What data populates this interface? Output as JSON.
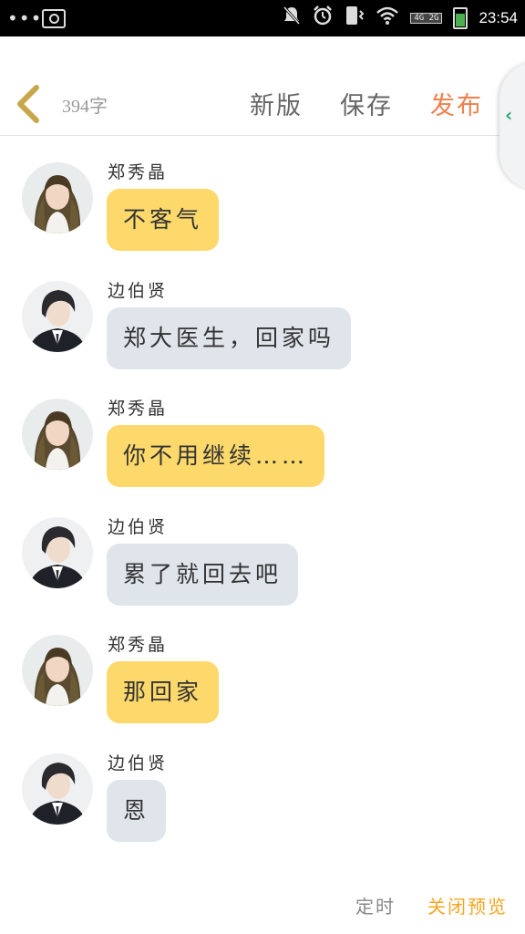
{
  "status_bar": {
    "time": "23:54",
    "network": "4G 2G",
    "icons": [
      "more-dots-icon",
      "screenshot-icon",
      "mute-icon",
      "alarm-icon",
      "vibrate-icon",
      "wifi-icon",
      "battery-icon"
    ]
  },
  "header": {
    "word_count": "394字",
    "new_version_label": "新版",
    "save_label": "保存",
    "publish_label": "发布",
    "publish_color": "#f07f4a"
  },
  "messages": [
    {
      "sender": "郑秀晶",
      "text": "不客气",
      "role": "female"
    },
    {
      "sender": "边伯贤",
      "text": "郑大医生，回家吗",
      "role": "male"
    },
    {
      "sender": "郑秀晶",
      "text": "你不用继续……",
      "role": "female"
    },
    {
      "sender": "边伯贤",
      "text": "累了就回去吧",
      "role": "male"
    },
    {
      "sender": "郑秀晶",
      "text": "那回家",
      "role": "female"
    },
    {
      "sender": "边伯贤",
      "text": "恩",
      "role": "male"
    }
  ],
  "colors": {
    "female_bubble": "#fdd96c",
    "male_bubble": "#dfe5eb",
    "close_preview": "#f5a623"
  },
  "footer": {
    "timer_label": "定时",
    "close_preview_label": "关闭预览"
  }
}
